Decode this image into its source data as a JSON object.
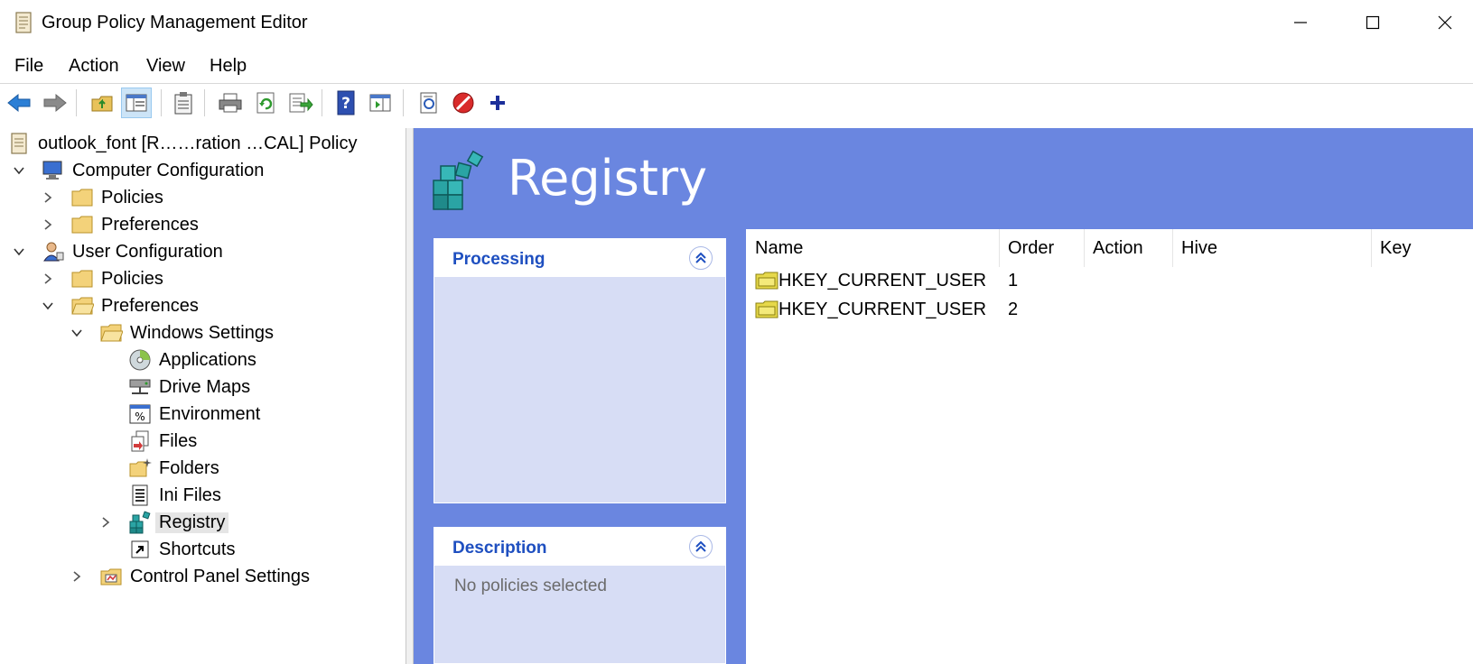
{
  "window": {
    "title": "Group Policy Management Editor",
    "icon": "policy-scroll-icon",
    "controls": [
      "minimize-icon",
      "maximize-icon",
      "close-icon"
    ]
  },
  "menu": {
    "file": "File",
    "action": "Action",
    "view": "View",
    "help": "Help"
  },
  "toolbar": {
    "buttons": [
      "back-arrow-icon",
      "forward-arrow-icon",
      "up-folder-icon",
      "show-hide-tree-icon",
      "clipboard-icon",
      "print-icon",
      "refresh-icon",
      "export-list-icon",
      "help-icon",
      "action-pane-icon",
      "properties-icon",
      "stop-icon",
      "add-icon"
    ]
  },
  "tree": {
    "root": "outlook_font [R……ration …CAL] Policy",
    "computer_config": "Computer Configuration",
    "cc_policies": "Policies",
    "cc_preferences": "Preferences",
    "user_config": "User Configuration",
    "uc_policies": "Policies",
    "uc_preferences": "Preferences",
    "windows_settings": "Windows Settings",
    "applications": "Applications",
    "drive_maps": "Drive Maps",
    "environment": "Environment",
    "files": "Files",
    "folders": "Folders",
    "ini_files": "Ini Files",
    "registry": "Registry",
    "shortcuts": "Shortcuts",
    "control_panel": "Control Panel Settings"
  },
  "main": {
    "title": "Registry",
    "processing": {
      "title": "Processing"
    },
    "description": {
      "title": "Description",
      "text": "No policies selected"
    },
    "columns": {
      "name": "Name",
      "order": "Order",
      "action": "Action",
      "hive": "Hive",
      "key": "Key"
    },
    "rows": [
      {
        "name": "HKEY_CURRENT_USER",
        "order": "1"
      },
      {
        "name": "HKEY_CURRENT_USER",
        "order": "2"
      }
    ]
  },
  "colors": {
    "pane_background": "#6a86e0",
    "panel_title": "#1e4fc0",
    "panel_body": "#d7ddf5"
  }
}
